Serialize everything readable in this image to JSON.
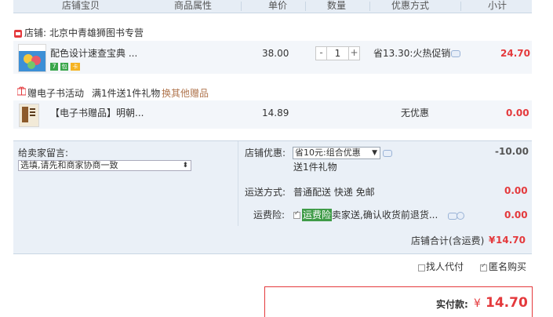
{
  "header": {
    "cols": [
      "店铺宝贝",
      "商品属性",
      "单价",
      "数量",
      "优惠方式",
      "小计"
    ]
  },
  "shop": {
    "label": "店铺:",
    "name": "北京中青雄狮图书专营"
  },
  "item1": {
    "title": "配色设计速查宝典 ...",
    "badges": [
      "7",
      "包",
      "卡"
    ],
    "price": "38.00",
    "qty": "1",
    "minus": "-",
    "plus": "+",
    "discount": "省13.30:火热促销",
    "subtotal": "24.70"
  },
  "gift_event": {
    "title": "赠电子书活动",
    "desc": "满1件送1件礼物",
    "other_link": "换其他赠品"
  },
  "item2": {
    "title": "【电子书赠品】明朝...",
    "price": "14.89",
    "discount": "无优惠",
    "subtotal": "0.00"
  },
  "message": {
    "label": "给卖家留言:",
    "placeholder": "选填,请先和商家协商一致"
  },
  "promo": {
    "label": "店铺优惠:",
    "select_value": "省10元:组合优惠",
    "note": "送1件礼物",
    "amount": "-10.00"
  },
  "shipping": {
    "label": "运送方式:",
    "value": "普通配送 快递 免邮",
    "amount": "0.00"
  },
  "insurance": {
    "label": "运费险:",
    "tag": "运费险",
    "desc": "卖家送,确认收货前退货...",
    "amount": "0.00"
  },
  "shop_total": {
    "label": "店铺合计(含运费)",
    "currency": "¥",
    "amount": "14.70"
  },
  "options": {
    "proxy_pay": "找人代付",
    "anonymous": "匿名购买"
  },
  "pay": {
    "label": "实付款:",
    "currency": "¥",
    "amount": "14.70"
  },
  "colors": {
    "accent": "#e4393c",
    "header_bg": "#e6edf5",
    "row_bg": "#f3f6fa",
    "summary_bg": "#eaf0f7",
    "link": "#b0754e"
  }
}
